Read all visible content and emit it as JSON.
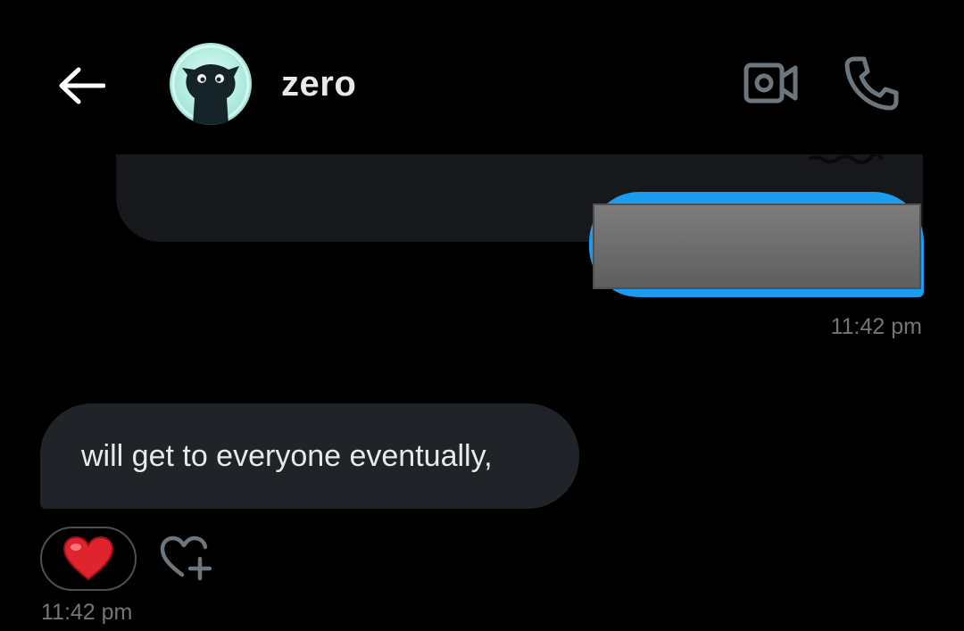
{
  "header": {
    "back_icon": "arrow-left-icon",
    "username": "zero",
    "video_icon": "video-camera-icon",
    "phone_icon": "phone-icon"
  },
  "messages": [
    {
      "direction": "sent",
      "content": "",
      "time": "11:42 pm"
    },
    {
      "direction": "received",
      "text": "will get to everyone eventually,",
      "time": "11:42 pm",
      "reaction": "❤️",
      "add_reaction_icon": "heart-plus-icon"
    }
  ],
  "colors": {
    "background": "#000000",
    "sent_bubble": "#1d9bf0",
    "received_bubble": "#202327",
    "timestamp": "#71767b",
    "text": "#e7e9ea"
  }
}
